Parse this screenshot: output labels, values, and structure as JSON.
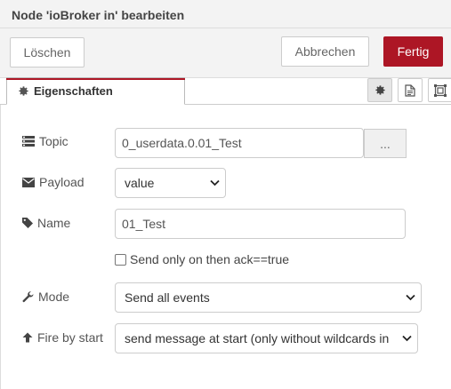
{
  "header": {
    "title": "Node 'ioBroker in' bearbeiten"
  },
  "buttons": {
    "delete": "Löschen",
    "cancel": "Abbrechen",
    "done": "Fertig"
  },
  "tabs": {
    "properties": "Eigenschaften"
  },
  "form": {
    "topic": {
      "label": "Topic",
      "value": "0_userdata.0.01_Test",
      "browse": "..."
    },
    "payload": {
      "label": "Payload",
      "value": "value"
    },
    "name": {
      "label": "Name",
      "value": "01_Test"
    },
    "ack_checkbox": {
      "label": "Send only on then ack==true"
    },
    "mode": {
      "label": "Mode",
      "value": "Send all events"
    },
    "fire": {
      "label": "Fire by start",
      "value": "send message at start (only without wildcards in"
    }
  },
  "colors": {
    "accent": "#ad1625"
  }
}
